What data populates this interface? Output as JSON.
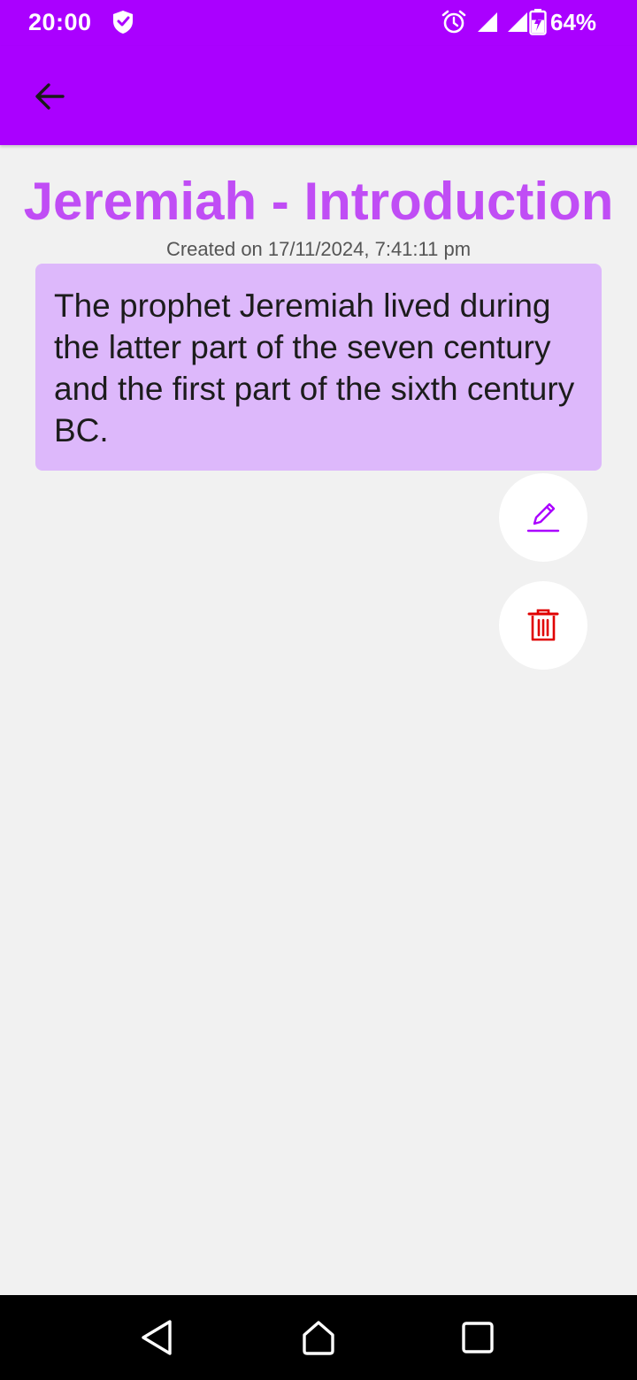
{
  "status_bar": {
    "time": "20:00",
    "battery_percent": "64%",
    "battery_level": 0.64,
    "icons": [
      "shield-icon",
      "alarm-icon",
      "signal-icon",
      "signal-icon",
      "battery-charging-icon"
    ]
  },
  "app_bar": {
    "back_icon": "arrow-left-icon"
  },
  "note": {
    "title": "Jeremiah - Introduction",
    "created": "Created on 17/11/2024, 7:41:11 pm",
    "body": "The prophet Jeremiah lived during the latter part of the seven century and the first part of the sixth century BC."
  },
  "actions": {
    "edit_icon": "pencil-icon",
    "delete_icon": "trash-icon"
  },
  "nav_bar": {
    "icons": [
      "nav-back-icon",
      "nav-home-icon",
      "nav-recents-icon"
    ]
  },
  "colors": {
    "accent": "#aa00ff",
    "title": "#c04df5",
    "card": "#ddb8fb",
    "delete": "#e00000",
    "background": "#f1f1f1"
  }
}
